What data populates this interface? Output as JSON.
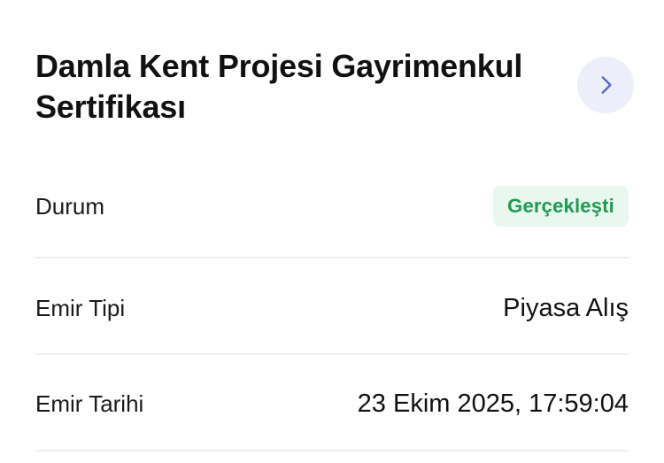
{
  "header": {
    "title": "Damla Kent Projesi Gayrimenkul Sertifikası"
  },
  "details": {
    "status": {
      "label": "Durum",
      "value": "Gerçekleşti",
      "color": "#1f9a55",
      "background": "#e8f8ee"
    },
    "order_type": {
      "label": "Emir Tipi",
      "value": "Piyasa Alış"
    },
    "order_date": {
      "label": "Emir Tarihi",
      "value": "23 Ekim 2025, 17:59:04"
    }
  },
  "icons": {
    "detail_button": "chevron-right-icon"
  },
  "colors": {
    "accent": "#5b63d3",
    "accent_bg": "#eceef9",
    "divider": "#efefef"
  }
}
